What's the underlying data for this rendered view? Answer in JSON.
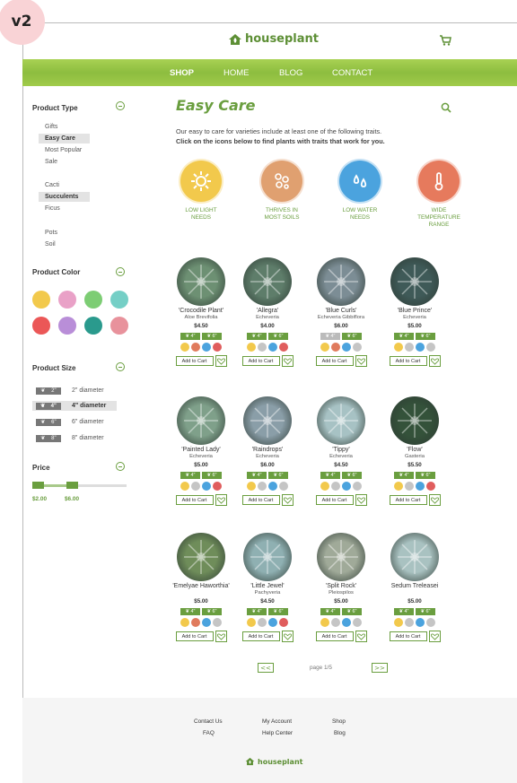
{
  "version_badge": "v2",
  "header": {
    "logo_text": "houseplant"
  },
  "nav": {
    "items": [
      "SHOP",
      "HOME",
      "BLOG",
      "CONTACT"
    ]
  },
  "sidebar": {
    "product_type": {
      "title": "Product Type",
      "groups": [
        [
          "Gifts",
          "Easy Care",
          "Most Popular",
          "Sale"
        ],
        [
          "Cacti",
          "Succulents",
          "Ficus"
        ],
        [
          "Pots",
          "Soil"
        ]
      ],
      "selected": [
        "Easy Care",
        "Succulents"
      ]
    },
    "product_color": {
      "title": "Product Color",
      "colors": [
        "#f2c94c",
        "#e9a1c7",
        "#7dcd74",
        "#75cfc6",
        "#eb5757",
        "#b98ed8",
        "#2a9a8d",
        "#e8929c"
      ]
    },
    "product_size": {
      "title": "Product Size",
      "rows": [
        {
          "badge": "2\"",
          "label": "2\" diameter"
        },
        {
          "badge": "4\"",
          "label": "4\" diameter"
        },
        {
          "badge": "6\"",
          "label": "6\" diameter"
        },
        {
          "badge": "8\"",
          "label": "8\" diameter"
        }
      ],
      "selected": "4\" diameter"
    },
    "price": {
      "title": "Price",
      "min": "$2.00",
      "max": "$6.00"
    }
  },
  "main": {
    "title": "Easy Care",
    "intro_line1": "Our easy to care for varieties include at least one of the following traits.",
    "intro_line2": "Click on the icons below to find plants with traits that work for you.",
    "traits": [
      {
        "label_1": "LOW LIGHT",
        "label_2": "NEEDS",
        "icon": "sun-icon",
        "color": "#f2c94c"
      },
      {
        "label_1": "THRIVES IN",
        "label_2": "MOST SOILS",
        "icon": "soil-icon",
        "color": "#e0a070"
      },
      {
        "label_1": "LOW WATER",
        "label_2": "NEEDS",
        "icon": "water-drops-icon",
        "color": "#4ba3de"
      },
      {
        "label_1": "WIDE",
        "label_2": "TEMPERATURE",
        "label_3": "RANGE",
        "icon": "thermometer-icon",
        "color": "#e67a5d"
      }
    ],
    "size_badges": [
      "4\"",
      "6\""
    ],
    "add_to_cart_label": "Add to Cart",
    "products": [
      {
        "name": "'Crocodile Plant'",
        "species": "Aloe Brevifolia",
        "price": "$4.50",
        "sizes": [
          true,
          true
        ],
        "traits": [
          true,
          true,
          true,
          true
        ],
        "plant_color": "#6d9073"
      },
      {
        "name": "'Allegra'",
        "species": "Echeveria",
        "price": "$4.00",
        "sizes": [
          true,
          true
        ],
        "traits": [
          true,
          false,
          true,
          true
        ],
        "plant_color": "#5e7d6a"
      },
      {
        "name": "'Blue Curls'",
        "species": "Echeveria Gibbiflora",
        "price": "$6.00",
        "sizes": [
          false,
          true
        ],
        "traits": [
          true,
          true,
          true,
          false
        ],
        "plant_color": "#7c8d95"
      },
      {
        "name": "'Blue Prince'",
        "species": "Echeveria",
        "price": "$5.00",
        "sizes": [
          true,
          true
        ],
        "traits": [
          true,
          false,
          true,
          false
        ],
        "plant_color": "#3f5a58"
      },
      {
        "name": "'Painted Lady'",
        "species": "Echeveria",
        "price": "$5.00",
        "sizes": [
          true,
          true
        ],
        "traits": [
          true,
          false,
          true,
          true
        ],
        "plant_color": "#7fa08a"
      },
      {
        "name": "'Raindrops'",
        "species": "Echeveria",
        "price": "$6.00",
        "sizes": [
          true,
          true
        ],
        "traits": [
          true,
          false,
          true,
          false
        ],
        "plant_color": "#8a9ea8"
      },
      {
        "name": "'Tippy'",
        "species": "Echeveria",
        "price": "$4.50",
        "sizes": [
          true,
          true
        ],
        "traits": [
          true,
          false,
          true,
          false
        ],
        "plant_color": "#a7c2c4"
      },
      {
        "name": "'Flow'",
        "species": "Gasteria",
        "price": "$5.50",
        "sizes": [
          true,
          true
        ],
        "traits": [
          true,
          false,
          true,
          true
        ],
        "plant_color": "#34523a"
      },
      {
        "name": "'Emelyae Haworthia'",
        "species": "",
        "price": "$5.00",
        "sizes": [
          true,
          true
        ],
        "traits": [
          true,
          true,
          true,
          false
        ],
        "plant_color": "#6f8d5a"
      },
      {
        "name": "'Little Jewel'",
        "species": "Pachyveria",
        "price": "$4.50",
        "sizes": [
          true,
          true
        ],
        "traits": [
          true,
          false,
          true,
          true
        ],
        "plant_color": "#8fb0b2"
      },
      {
        "name": "'Split Rock'",
        "species": "Pleiospilos",
        "price": "$5.00",
        "sizes": [
          true,
          true
        ],
        "traits": [
          true,
          false,
          true,
          false
        ],
        "plant_color": "#a0aa99"
      },
      {
        "name": "Sedum Treleasei",
        "species": "",
        "price": "$5.00",
        "sizes": [
          true,
          true
        ],
        "traits": [
          true,
          false,
          true,
          false
        ],
        "plant_color": "#a9c2c1"
      }
    ],
    "pager": {
      "prev": "<<",
      "text": "page 1/5",
      "next": ">>"
    }
  },
  "footer": {
    "col1": [
      "Contact Us",
      "FAQ"
    ],
    "col2": [
      "My Account",
      "Help Center"
    ],
    "col3": [
      "Shop",
      "Blog"
    ],
    "logo_text": "houseplant"
  }
}
